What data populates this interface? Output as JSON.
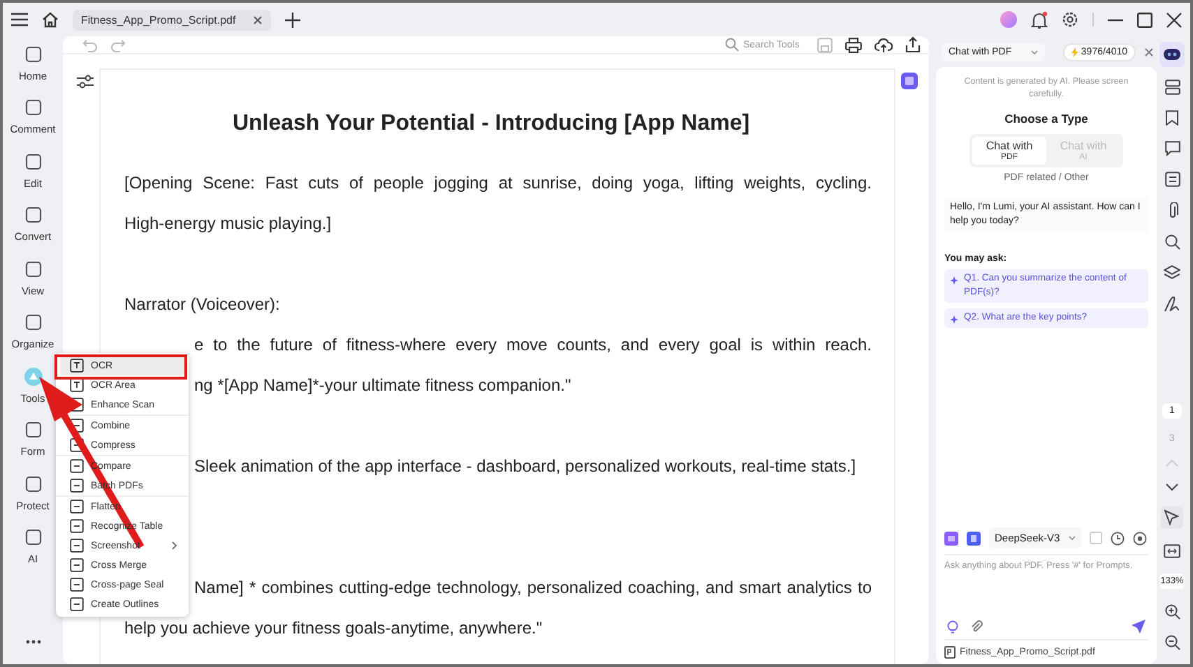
{
  "tab": {
    "title": "Fitness_App_Promo_Script.pdf"
  },
  "nav": [
    {
      "label": "Home",
      "selected": false
    },
    {
      "label": "Comment",
      "selected": false
    },
    {
      "label": "Edit",
      "selected": false
    },
    {
      "label": "Convert",
      "selected": false
    },
    {
      "label": "View",
      "selected": false
    },
    {
      "label": "Organize",
      "selected": false
    },
    {
      "label": "Tools",
      "selected": true
    },
    {
      "label": "Form",
      "selected": false
    },
    {
      "label": "Protect",
      "selected": false
    },
    {
      "label": "AI",
      "selected": false
    }
  ],
  "toolbar": {
    "search_placeholder": "Search Tools"
  },
  "document": {
    "title": "Unleash Your Potential - Introducing [App Name]",
    "paragraphs": [
      {
        "lines": [
          {
            "text": "[Opening Scene: Fast cuts of people jogging at sunrise, doing yoga, lifting weights, cycling.",
            "kind": "wrapped",
            "covered": false
          },
          {
            "text": "High-energy music playing.]",
            "kind": "end",
            "covered": false
          }
        ]
      },
      {
        "lines": [
          {
            "text": "Narrator (Voiceover):",
            "kind": "end",
            "covered": false
          },
          {
            "text": "e to the future of fitness-where every move counts, and every goal is within reach.",
            "kind": "wrapped",
            "covered": true
          },
          {
            "text": "ng *[App Name]*-your ultimate fitness companion.\"",
            "kind": "end",
            "covered": true
          }
        ]
      },
      {
        "lines": [
          {
            "text": "Sleek animation of the app interface - dashboard, personalized workouts, real-time stats.]",
            "kind": "end",
            "covered": true
          }
        ]
      },
      {
        "lines": [
          {
            "text": "Name] * combines cutting-edge technology, personalized coaching, and smart analytics to",
            "kind": "wrapped",
            "covered": true
          },
          {
            "text": "help you achieve your fitness goals-anytime, anywhere.\"",
            "kind": "end",
            "covered": false
          }
        ]
      }
    ]
  },
  "tools_menu": {
    "groups": [
      [
        {
          "label": "OCR",
          "selected": true
        },
        {
          "label": "OCR Area",
          "selected": false
        },
        {
          "label": "Enhance Scan",
          "selected": false
        }
      ],
      [
        {
          "label": "Combine",
          "selected": false
        },
        {
          "label": "Compress",
          "selected": false
        }
      ],
      [
        {
          "label": "Compare",
          "selected": false
        },
        {
          "label": "Batch PDFs",
          "selected": false
        }
      ],
      [
        {
          "label": "Flatten",
          "selected": false
        },
        {
          "label": "Recognize Table",
          "selected": false
        },
        {
          "label": "Screenshot",
          "selected": false,
          "submenu": true
        },
        {
          "label": "Cross Merge",
          "selected": false
        },
        {
          "label": "Cross-page Seal",
          "selected": false
        },
        {
          "label": "Create Outlines",
          "selected": false
        }
      ]
    ]
  },
  "chat": {
    "mode": "Chat with PDF",
    "credits": "3976/4010",
    "notice": "Content is generated by AI. Please screen carefully.",
    "type_heading": "Choose a Type",
    "types": [
      {
        "label": "Chat with",
        "sub": "PDF",
        "selected": true
      },
      {
        "label": "Chat with",
        "sub": "AI",
        "selected": false
      }
    ],
    "type_hint": "PDF related / Other",
    "greeting": "Hello, I'm Lumi, your AI assistant. How can I help you today?",
    "ask_heading": "You may ask:",
    "questions": [
      "Q1. Can you summarize the content of PDF(s)?",
      "Q2. What are the key points?"
    ],
    "model": "DeepSeek-V3",
    "placeholder": "Ask anything about PDF. Press '#' for Prompts.",
    "file": "Fitness_App_Promo_Script.pdf"
  },
  "pager": {
    "current": "1",
    "total": "3",
    "zoom": "133%"
  }
}
